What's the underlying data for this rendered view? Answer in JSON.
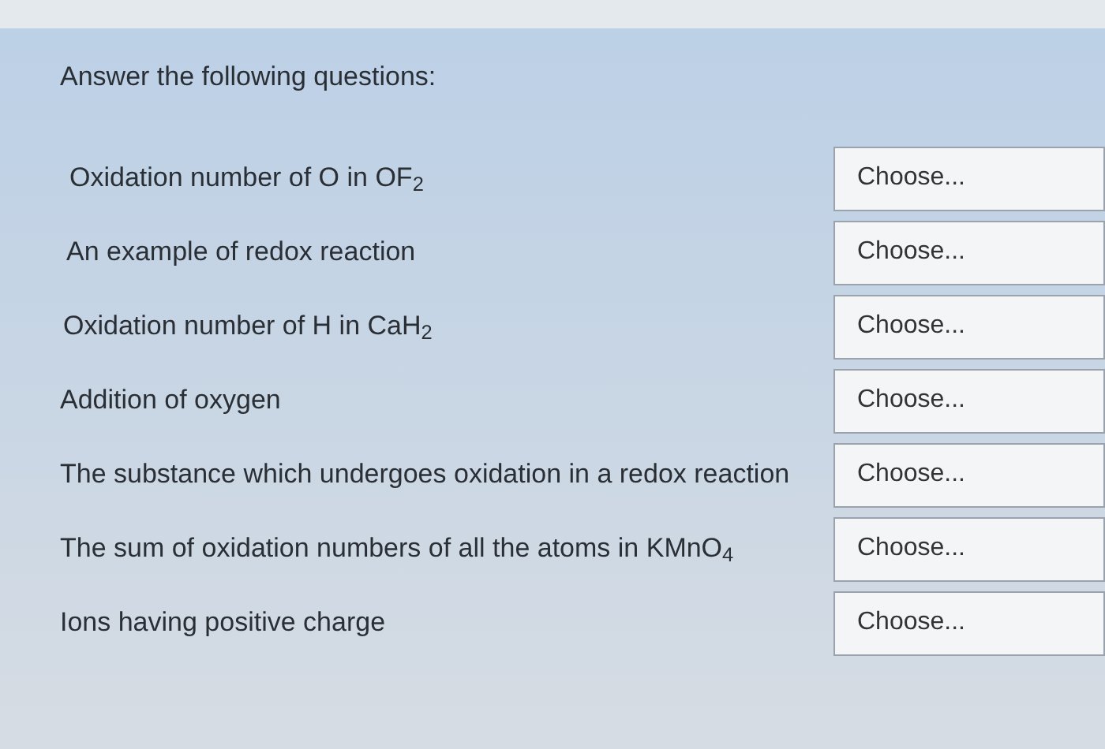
{
  "heading": "Answer the following questions:",
  "questions": [
    {
      "label": "Oxidation number of O in OF$_{2}$",
      "placeholder": "Choose..."
    },
    {
      "label": "An example of redox reaction",
      "placeholder": "Choose..."
    },
    {
      "label": "Oxidation number of H in CaH$_{2}$",
      "placeholder": "Choose..."
    },
    {
      "label": "Addition of oxygen",
      "placeholder": "Choose..."
    },
    {
      "label": "The substance which undergoes oxidation in a redox reaction",
      "placeholder": "Choose..."
    },
    {
      "label": "The sum of oxidation numbers of all the atoms in KMnO$_{4}$",
      "placeholder": "Choose..."
    },
    {
      "label": "Ions having positive charge",
      "placeholder": "Choose..."
    }
  ]
}
